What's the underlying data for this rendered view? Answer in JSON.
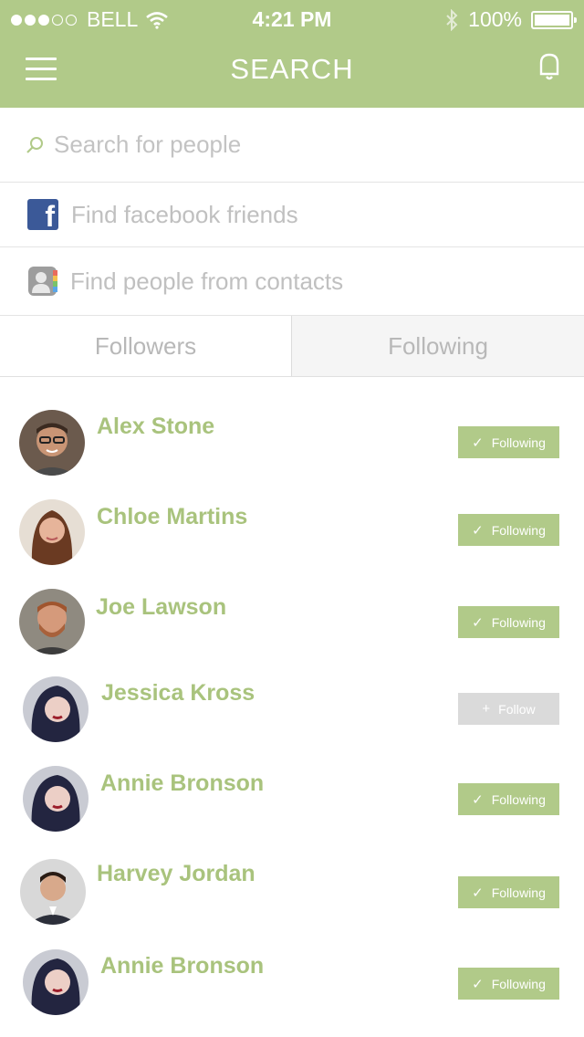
{
  "status_bar": {
    "carrier": "BELL",
    "signal_icon": "signal-dots-icon",
    "wifi_icon": "wifi-icon",
    "time": "4:21 PM",
    "bluetooth_icon": "bluetooth-icon",
    "battery_text": "100%",
    "battery_icon": "battery-icon"
  },
  "header": {
    "title": "SEARCH",
    "menu_icon": "hamburger-menu-icon",
    "notification_icon": "bell-icon",
    "background_color": "#b1ca89"
  },
  "search": {
    "placeholder": "Search for people",
    "value": "",
    "icon": "search-icon"
  },
  "options": [
    {
      "label": "Find facebook friends",
      "icon": "facebook-icon"
    },
    {
      "label": "Find people from contacts",
      "icon": "contacts-icon"
    }
  ],
  "tabs": [
    {
      "label": "Followers",
      "active": false
    },
    {
      "label": "Following",
      "active": true
    }
  ],
  "users": [
    {
      "name": "Alex Stone",
      "button": "Following",
      "state": "following"
    },
    {
      "name": "Chloe Martins",
      "button": "Following",
      "state": "following"
    },
    {
      "name": "Joe Lawson",
      "button": "Following",
      "state": "following"
    },
    {
      "name": "Jessica Kross",
      "button": "Follow",
      "state": "follow"
    },
    {
      "name": "Annie Bronson",
      "button": "Following",
      "state": "following"
    },
    {
      "name": "Harvey Jordan",
      "button": "Following",
      "state": "following"
    },
    {
      "name": "Annie Bronson",
      "button": "Following",
      "state": "following"
    }
  ],
  "colors": {
    "accent": "#b1ca89",
    "name_text": "#a9c37d",
    "follow_inactive": "#dadada"
  }
}
